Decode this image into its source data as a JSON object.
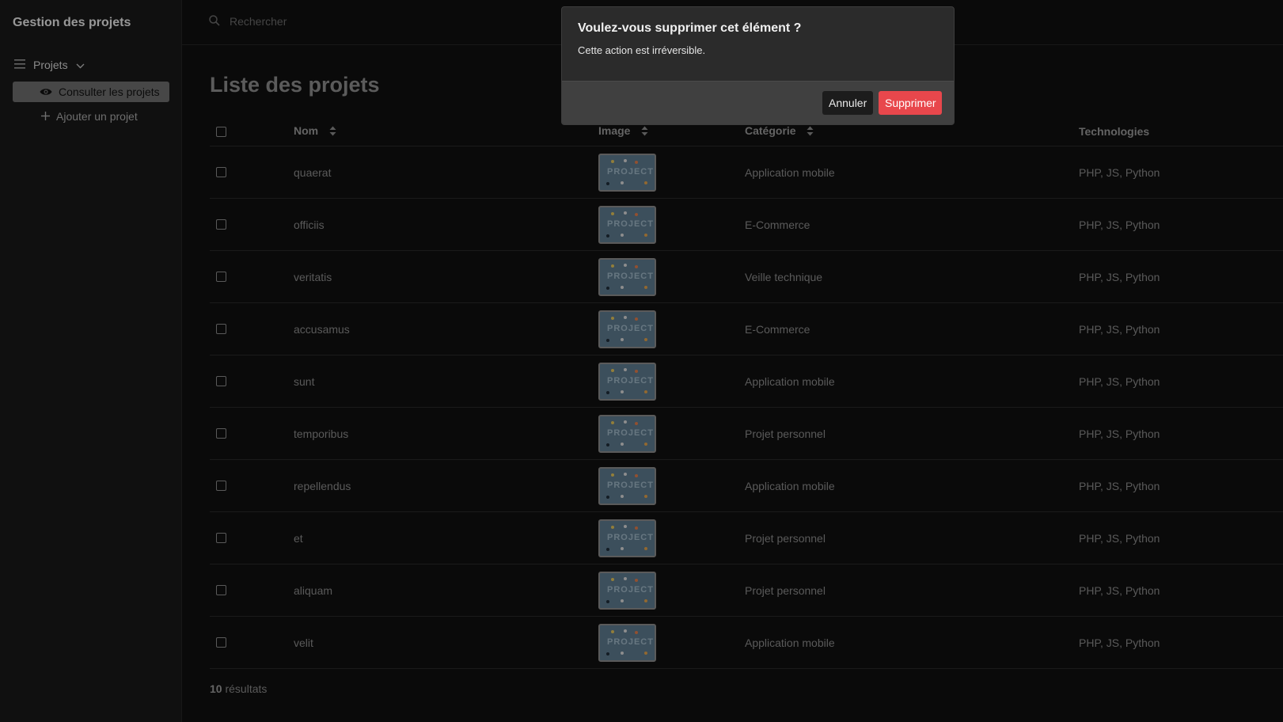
{
  "app": {
    "title": "Gestion des projets"
  },
  "sidebar": {
    "group_label": "Projets",
    "items": [
      {
        "label": "Consulter les projets",
        "active": true,
        "icon": "eye-icon"
      },
      {
        "label": "Ajouter un projet",
        "active": false,
        "icon": "plus-icon"
      }
    ]
  },
  "search": {
    "placeholder": "Rechercher",
    "value": ""
  },
  "page": {
    "title": "Liste des projets"
  },
  "table": {
    "columns": [
      "Nom",
      "Image",
      "Catégorie",
      "Technologies"
    ],
    "image_label": "PROJECT",
    "rows": [
      {
        "name": "quaerat",
        "category": "Application mobile",
        "tech": "PHP, JS, Python"
      },
      {
        "name": "officiis",
        "category": "E-Commerce",
        "tech": "PHP, JS, Python"
      },
      {
        "name": "veritatis",
        "category": "Veille technique",
        "tech": "PHP, JS, Python"
      },
      {
        "name": "accusamus",
        "category": "E-Commerce",
        "tech": "PHP, JS, Python"
      },
      {
        "name": "sunt",
        "category": "Application mobile",
        "tech": "PHP, JS, Python"
      },
      {
        "name": "temporibus",
        "category": "Projet personnel",
        "tech": "PHP, JS, Python"
      },
      {
        "name": "repellendus",
        "category": "Application mobile",
        "tech": "PHP, JS, Python"
      },
      {
        "name": "et",
        "category": "Projet personnel",
        "tech": "PHP, JS, Python"
      },
      {
        "name": "aliquam",
        "category": "Projet personnel",
        "tech": "PHP, JS, Python"
      },
      {
        "name": "velit",
        "category": "Application mobile",
        "tech": "PHP, JS, Python"
      }
    ]
  },
  "footer": {
    "count": "10",
    "count_label": "résultats"
  },
  "modal": {
    "title": "Voulez-vous supprimer cet élément ?",
    "text": "Cette action est irréversible.",
    "cancel_label": "Annuler",
    "confirm_label": "Supprimer"
  },
  "colors": {
    "danger": "#e8474c",
    "accent_active": "#6d6d6d"
  }
}
